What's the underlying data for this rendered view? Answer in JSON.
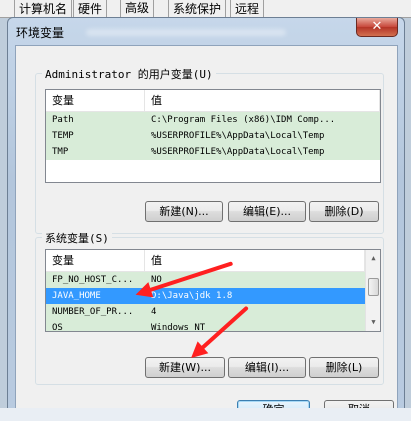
{
  "background_tabs": [
    "计算机名",
    "硬件",
    "高级",
    "系统保护",
    "远程"
  ],
  "window": {
    "title": "环境变量",
    "close_glyph": "✕"
  },
  "user_vars": {
    "label": "Administrator 的用户变量(U)",
    "columns": [
      "变量",
      "值"
    ],
    "rows": [
      {
        "name": "Path",
        "value": "C:\\Program Files (x86)\\IDM Comp..."
      },
      {
        "name": "TEMP",
        "value": "%USERPROFILE%\\AppData\\Local\\Temp"
      },
      {
        "name": "TMP",
        "value": "%USERPROFILE%\\AppData\\Local\\Temp"
      }
    ],
    "buttons": {
      "new": "新建(N)...",
      "edit": "编辑(E)...",
      "delete": "删除(D)"
    }
  },
  "system_vars": {
    "label": "系统变量(S)",
    "columns": [
      "变量",
      "值"
    ],
    "rows": [
      {
        "name": "FP_NO_HOST_C...",
        "value": "NO"
      },
      {
        "name": "JAVA_HOME",
        "value": "D:\\Java\\jdk 1.8",
        "selected": true
      },
      {
        "name": "NUMBER_OF_PR...",
        "value": "4"
      },
      {
        "name": "OS",
        "value": "Windows_NT"
      }
    ],
    "buttons": {
      "new": "新建(W)...",
      "edit": "编辑(I)...",
      "delete": "删除(L)"
    }
  },
  "footer": {
    "ok": "确定",
    "cancel": "取消"
  },
  "colors": {
    "row_bg": "#d8ecd8",
    "selection": "#3399ff",
    "annotation_arrow": "#ff2020"
  }
}
